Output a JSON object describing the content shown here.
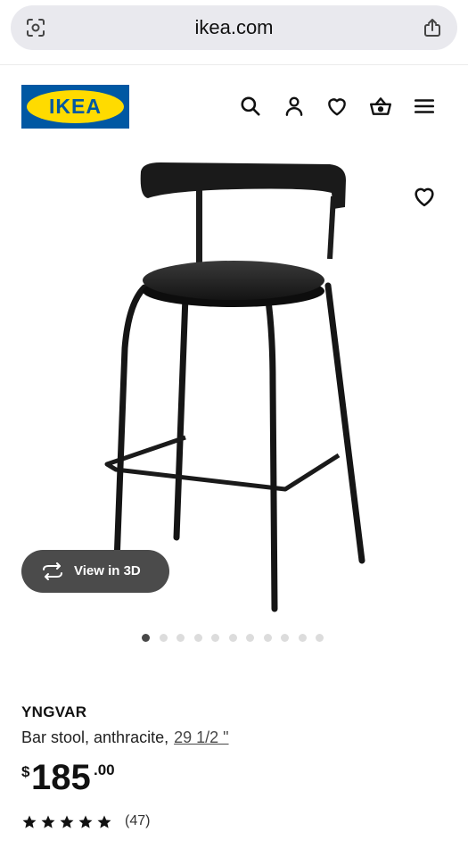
{
  "browser": {
    "url": "ikea.com",
    "left_icon": "lens-scan-icon",
    "right_icon": "share-icon"
  },
  "header": {
    "logo_text": "IKEA",
    "icons": [
      "search-icon",
      "account-icon",
      "heart-icon",
      "basket-icon",
      "menu-icon"
    ]
  },
  "product": {
    "view3d_label": "View in 3D",
    "carousel": {
      "total": 11,
      "active_index": 0
    },
    "name": "YNGVAR",
    "description": "Bar stool, anthracite,",
    "size": "29 1/2 \"",
    "price": {
      "currency": "$",
      "integer": "185",
      "decimal": ".00"
    },
    "rating": {
      "stars": 5,
      "count": "(47)"
    }
  },
  "colors": {
    "ikea_blue": "#0058a3",
    "ikea_yellow": "#ffdb00",
    "view3d_bg": "#4b4b4b"
  }
}
